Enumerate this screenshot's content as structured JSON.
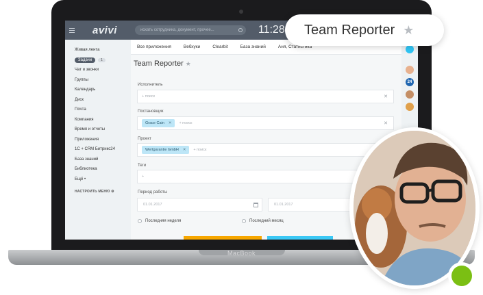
{
  "app": {
    "logo": "avivi",
    "search_placeholder": "искать сотрудника, документ, прочее...",
    "clock": "11:28"
  },
  "leftmenu": {
    "items": [
      {
        "label": "Живая лента"
      },
      {
        "label": "Задачи",
        "badge": "1",
        "active": true
      },
      {
        "label": "Чат и звонки"
      },
      {
        "label": "Группы"
      },
      {
        "label": "Календарь"
      },
      {
        "label": "Диск"
      },
      {
        "label": "Почта"
      },
      {
        "label": "Компания"
      },
      {
        "label": "Время и отчеты"
      },
      {
        "label": "Приложения"
      },
      {
        "label": "1С + CRM Битрикс24"
      },
      {
        "label": "База знаний"
      },
      {
        "label": "Библиотека"
      },
      {
        "label": "Ещё •"
      }
    ],
    "settings_label": "НАСТРОИТЬ МЕНЮ"
  },
  "tabs": [
    "Все приложения",
    "Вебхуки",
    "Clearbit",
    "База знаний",
    "Аня, Статистика"
  ],
  "panel": {
    "title": "Team Reporter",
    "fields": {
      "executor_label": "Исполнитель",
      "executor_placeholder": "+ поиск",
      "director_label": "Постановщик",
      "director_tag": "Grace Cain",
      "director_placeholder": "+ поиск",
      "project_label": "Проект",
      "project_tag": "Wertgarantie GmbH",
      "project_placeholder": "+ поиск",
      "tags_label": "Теги",
      "tags_placeholder": "+",
      "period_label": "Период работы",
      "date_from": "01.01.2017",
      "date_to": "01.01.2017",
      "last_week": "Последняя неделя",
      "last_month": "Последний месяц"
    }
  },
  "callout": {
    "title": "Team Reporter"
  },
  "device": {
    "brand": "MacBook"
  },
  "right_badge": "24",
  "colors": {
    "topbar": "#535c69",
    "tag": "#bde6f7",
    "find_button": "#f7a700",
    "reset_button": "#3bc8f5",
    "online": "#7bbf13"
  }
}
